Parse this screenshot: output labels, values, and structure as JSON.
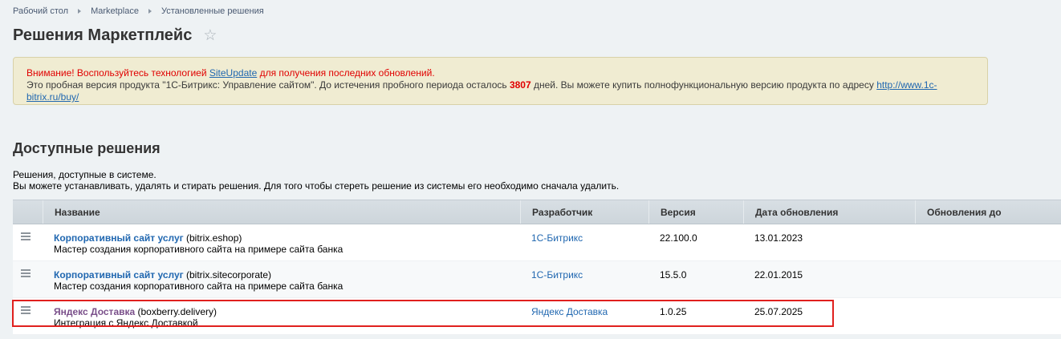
{
  "breadcrumb": [
    "Рабочий стол",
    "Marketplace",
    "Установленные решения"
  ],
  "page_title": "Решения Маркетплейс",
  "notice": {
    "warning_prefix": "Внимание! Воспользуйтесь технологией ",
    "warning_link": "SiteUpdate",
    "warning_suffix": " для получения последних обновлений.",
    "trial_prefix": "Это пробная версия продукта \"1С-Битрикс: Управление сайтом\". До истечения пробного периода осталось ",
    "trial_days": "3807",
    "trial_middle": " дней. Вы можете купить полнофункциональную версию продукта по адресу ",
    "trial_link": "http://www.1c-bitrix.ru/buy/"
  },
  "section_title": "Доступные решения",
  "description": {
    "line1": "Решения, доступные в системе.",
    "line2": "Вы можете устанавливать, удалять и стирать решения. Для того чтобы стереть решение из системы его необходимо сначала удалить."
  },
  "table": {
    "columns": [
      "Название",
      "Разработчик",
      "Версия",
      "Дата обновления",
      "Обновления до"
    ],
    "rows": [
      {
        "name": "Корпоративный сайт услуг",
        "code": " (bitrix.eshop)",
        "desc": "Мастер создания корпоративного сайта на примере сайта банка",
        "developer": "1С-Битрикс",
        "version": "22.100.0",
        "date": "13.01.2023",
        "updates_until": ""
      },
      {
        "name": "Корпоративный сайт услуг",
        "code": " (bitrix.sitecorporate)",
        "desc": "Мастер создания корпоративного сайта на примере сайта банка",
        "developer": "1С-Битрикс",
        "version": "15.5.0",
        "date": "22.01.2015",
        "updates_until": ""
      },
      {
        "name": "Яндекс Доставка",
        "code": " (boxberry.delivery)",
        "desc": "Интеграция с Яндекс Доставкой",
        "developer": "Яндекс Доставка",
        "version": "1.0.25",
        "date": "25.07.2025",
        "updates_until": ""
      }
    ]
  },
  "colors": {
    "background": "#eef2f4",
    "link": "#2067b0",
    "warning": "#e00000",
    "highlight": "#e0201e"
  }
}
